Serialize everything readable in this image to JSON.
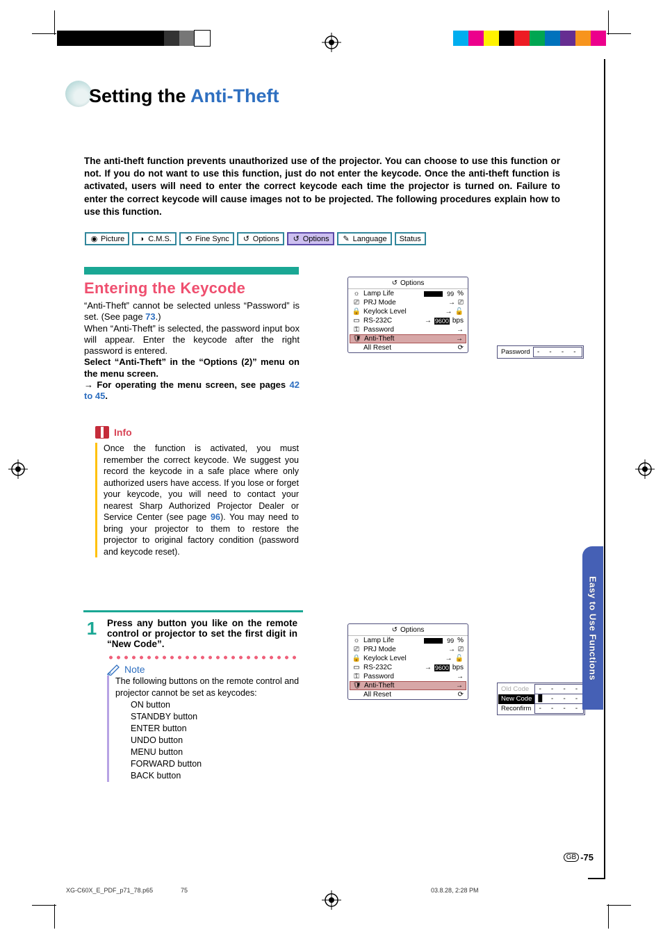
{
  "title": {
    "prefix": "Setting the ",
    "accent": "Anti-Theft"
  },
  "intro": "The anti-theft function prevents unauthorized use of the projector. You can choose to use this function or not. If you do not want to use this function, just do not enter the keycode. Once the anti-theft function is activated, users will need to enter the correct keycode each time the projector is turned on. Failure to enter the correct keycode will cause images not to be projected. The following procedures explain how to use this function.",
  "menu_tabs": [
    "Picture",
    "C.M.S.",
    "Fine Sync",
    "Options",
    "Options",
    "Language",
    "Status"
  ],
  "section_heading": "Entering the Keycode",
  "para_a": "“Anti-Theft” cannot be selected unless “Password” is set. (See page ",
  "para_a_ref": "73",
  "para_a_tail": ".)",
  "para_b": "When “Anti-Theft” is selected, the password input box will appear. Enter the keycode after the right password is entered.",
  "para_c": "Select “Anti-Theft” in the “Options (2)” menu on the menu screen.",
  "para_d_prefix": "→ For operating the menu screen, see pages ",
  "para_d_ref": "42 to 45",
  "para_d_tail": ".",
  "info_label": "Info",
  "info_text_a": "Once the function is activated, you must remember the correct keycode. We suggest you record the keycode in a safe place where only authorized users have access. If you lose or forget your keycode, you will need to contact your nearest Sharp Authorized Projector Dealer or Service Center (see page ",
  "info_ref": "96",
  "info_text_b": "). You may need to bring your projector to them to restore the projector to original factory condition (password and keycode reset).",
  "step": {
    "num": "1",
    "text": "Press any button you like on the remote control or projector to set the first digit in “New Code”."
  },
  "note_label": "Note",
  "note_intro": "The following buttons on the remote control and projector cannot be set as keycodes:",
  "note_items": [
    "ON button",
    "STANDBY button",
    "ENTER button",
    "UNDO button",
    "MENU button",
    "FORWARD button",
    "BACK button"
  ],
  "osd": {
    "title": "Options",
    "rows": [
      {
        "label": "Lamp Life",
        "right": "99",
        "suffix": "%",
        "bar": true
      },
      {
        "label": "PRJ Mode",
        "arrow": true,
        "icon": "prj"
      },
      {
        "label": "Keylock Level",
        "arrow": true,
        "icon": "lock"
      },
      {
        "label": "RS-232C",
        "arrow": true,
        "badge": "9600",
        "suffix": "bps"
      },
      {
        "label": "Password",
        "arrow": true,
        "iconleft": "key"
      },
      {
        "label": "Anti-Theft",
        "arrow": true,
        "iconleft": "shield",
        "hl": true
      },
      {
        "label": "All Reset",
        "reset": true
      }
    ]
  },
  "pass1": {
    "label": "Password",
    "value": "- - - -"
  },
  "pass2": {
    "rows": [
      {
        "label": "Old Code",
        "value": "- - - -",
        "dim": true
      },
      {
        "label": "New Code",
        "value": "█ - - -",
        "hot": true
      },
      {
        "label": "Reconfirm",
        "value": "- - - -"
      }
    ]
  },
  "side_tab": "Easy to Use Functions",
  "page_label_prefix": "GB",
  "page_number": "-75",
  "meta": {
    "file": "XG-C60X_E_PDF_p71_78.p65",
    "page": "75",
    "date": "03.8.28, 2:28 PM"
  },
  "colorbars": {
    "left": [
      "#000",
      "#000",
      "#000",
      "#000",
      "#000",
      "#000",
      "#000",
      "#333",
      "#777",
      "#fff"
    ],
    "right": [
      "#00aeef",
      "#ec008c",
      "#fff200",
      "#000",
      "#ed1c24",
      "#00a651",
      "#0072bc",
      "#662d91",
      "#f7941d",
      "#ec008c"
    ]
  }
}
